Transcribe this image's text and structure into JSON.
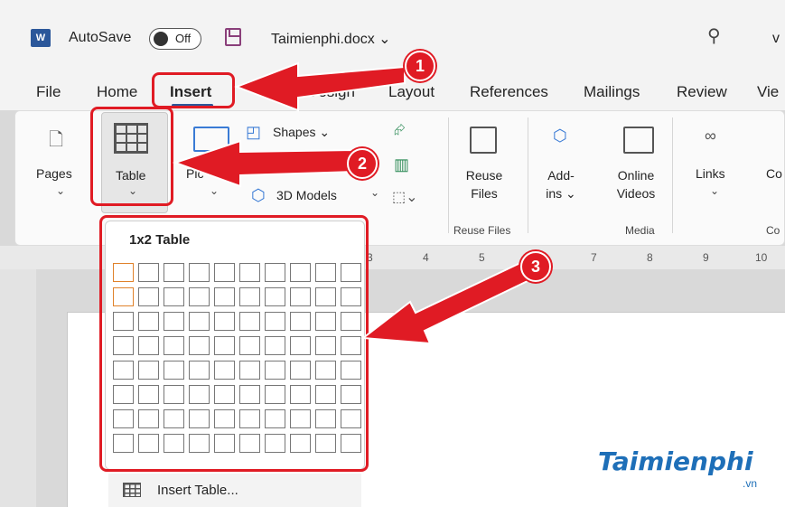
{
  "titlebar": {
    "app_logo": "W",
    "autosave_label": "AutoSave",
    "toggle_state": "Off",
    "filename": "Taimienphi.docx ⌄",
    "user_initial": "v"
  },
  "tabs": [
    {
      "label": "File"
    },
    {
      "label": "Home"
    },
    {
      "label": "Insert"
    },
    {
      "label": "Design"
    },
    {
      "label": "Layout"
    },
    {
      "label": "References"
    },
    {
      "label": "Mailings"
    },
    {
      "label": "Review"
    },
    {
      "label": "Vie"
    }
  ],
  "ribbon": {
    "pages": "Pages",
    "table": "Table",
    "pictures": "Pic",
    "shapes": "Shapes ⌄",
    "models_3d": "3D Models",
    "reuse_files": "Reuse Files",
    "reuse_files_group": "Reuse Files",
    "addins": "Add-ins ⌄",
    "online_videos": "Online Videos",
    "media_group": "Media",
    "links": "Links",
    "comments_partial": "Co",
    "comments_group_partial": "Co"
  },
  "ruler": {
    "marks": [
      "3",
      "4",
      "5",
      "7",
      "8",
      "9",
      "10"
    ]
  },
  "dropdown": {
    "title": "1x2 Table",
    "rows": 8,
    "cols": 10,
    "selected_rows": 2,
    "selected_cols": 1,
    "insert_table": "Insert Table..."
  },
  "annotations": {
    "step1": "1",
    "step2": "2",
    "step3": "3",
    "color": "#e01b24"
  },
  "watermark": {
    "text": "Taimienphi",
    "sub": ".vn"
  }
}
